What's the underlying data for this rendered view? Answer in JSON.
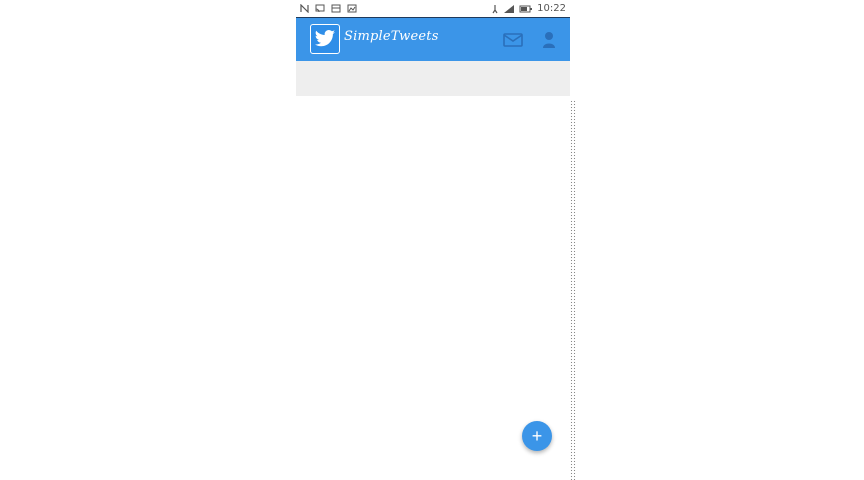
{
  "status_bar": {
    "time": "10:22",
    "left_icons": [
      "nfc-icon",
      "cast-icon",
      "screenshot-icon",
      "gallery-icon"
    ],
    "right_icons": [
      "alarm-icon",
      "signal-icon",
      "battery-icon"
    ]
  },
  "app_bar": {
    "title": "SimpleTweets",
    "logo": "twitter-bird-icon",
    "actions": [
      "compose-icon",
      "profile-icon"
    ]
  },
  "fab": {
    "label": "+",
    "icon": "add-icon"
  },
  "colors": {
    "app_bar": "#3b95e8",
    "tab_strip": "#eeeeee",
    "background": "#ffffff"
  }
}
